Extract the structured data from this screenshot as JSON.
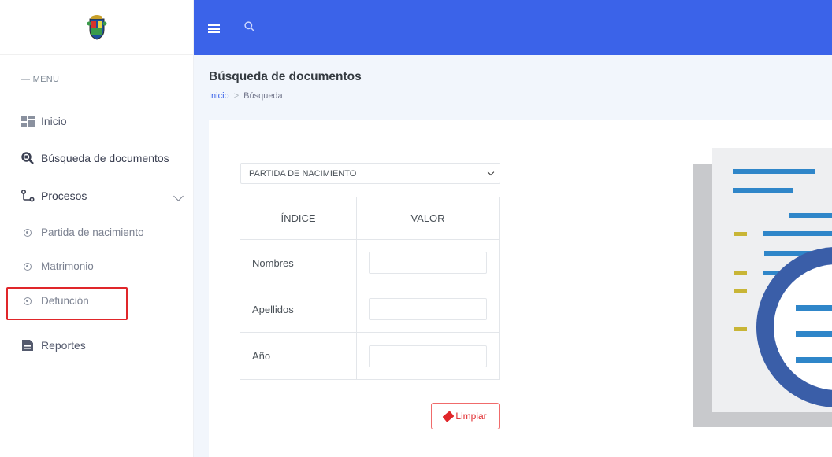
{
  "sidebar": {
    "menu_title": "— MENU",
    "items": [
      {
        "label": "Inicio",
        "icon": "dashboard-icon"
      },
      {
        "label": "Búsqueda de documentos",
        "icon": "search-doc-icon"
      },
      {
        "label": "Procesos",
        "icon": "process-icon"
      },
      {
        "label": "Partida de nacimiento",
        "icon": "circle-dot-icon"
      },
      {
        "label": "Matrimonio",
        "icon": "circle-dot-icon"
      },
      {
        "label": "Defunción",
        "icon": "circle-dot-icon"
      },
      {
        "label": "Reportes",
        "icon": "report-icon"
      }
    ]
  },
  "page": {
    "title": "Búsqueda de documentos",
    "breadcrumb": {
      "home": "Inicio",
      "current": "Búsqueda"
    }
  },
  "form": {
    "document_type": "PARTIDA DE NACIMIENTO",
    "table": {
      "headers": [
        "ÍNDICE",
        "VALOR"
      ],
      "rows": [
        {
          "label": "Nombres",
          "value": ""
        },
        {
          "label": "Apellidos",
          "value": ""
        },
        {
          "label": "Año",
          "value": ""
        }
      ]
    },
    "clear_button": "Limpiar"
  },
  "colors": {
    "topbar": "#3b63e9",
    "highlight": "#e0262a",
    "illus_blue": "#2f86c9",
    "illus_ring": "#3a5ea8",
    "illus_yellow": "#c8b536"
  }
}
